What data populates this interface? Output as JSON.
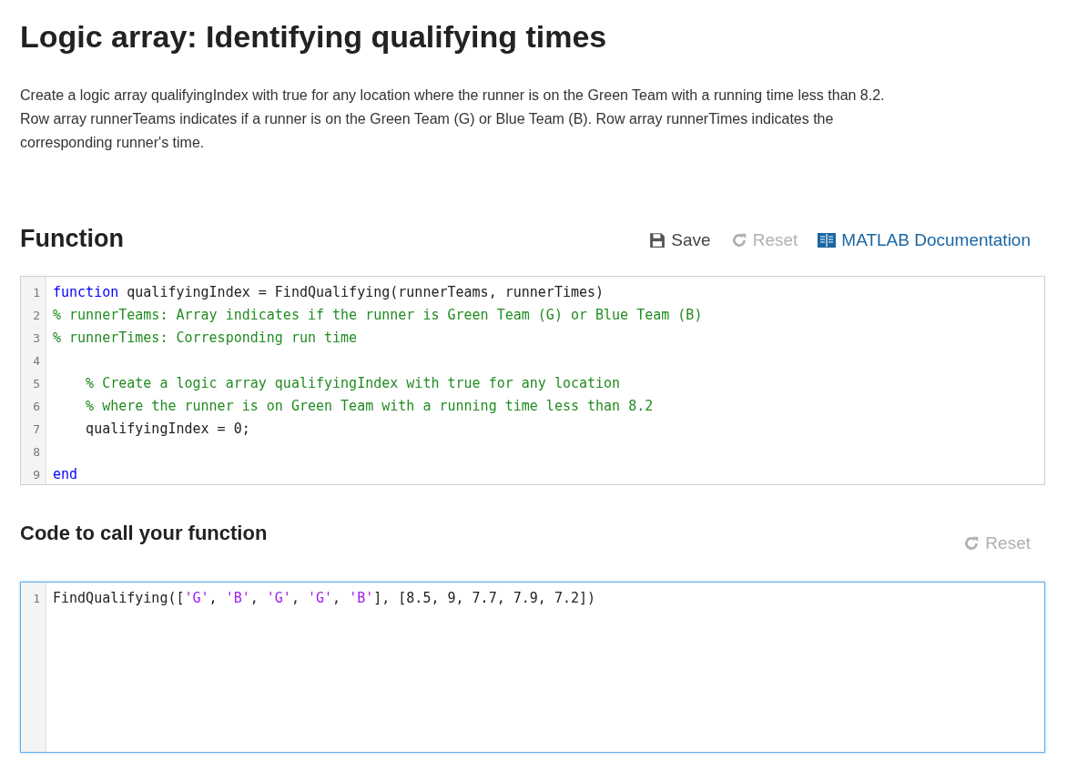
{
  "title": "Logic array: Identifying qualifying times",
  "description": [
    "Create a logic array qualifyingIndex with true for any location where the runner is on the Green Team with a running time less than 8.2.",
    "Row array runnerTeams indicates if a runner is on the Green Team (G) or Blue Team (B). Row array runnerTimes indicates the corresponding runner's time."
  ],
  "function_section": {
    "heading": "Function",
    "toolbar": [
      {
        "kind": "save",
        "label": "Save",
        "disabled": false
      },
      {
        "kind": "reset",
        "label": "Reset",
        "disabled": true
      },
      {
        "kind": "docs",
        "label": "MATLAB Documentation",
        "disabled": false
      }
    ],
    "editor": {
      "focused": false,
      "lines": [
        {
          "number": "1",
          "tokens": [
            {
              "kind": "keyword",
              "text": "function"
            },
            {
              "kind": "plain",
              "text": " qualifyingIndex = FindQualifying(runnerTeams, runnerTimes)"
            }
          ]
        },
        {
          "number": "2",
          "tokens": [
            {
              "kind": "comment",
              "text": "% runnerTeams: Array indicates if the runner is Green Team (G) or Blue Team (B)"
            }
          ]
        },
        {
          "number": "3",
          "tokens": [
            {
              "kind": "comment",
              "text": "% runnerTimes: Corresponding run time"
            }
          ]
        },
        {
          "number": "4"
        },
        {
          "number": "5",
          "tokens": [
            {
              "kind": "comment",
              "text": "    % Create a logic array qualifyingIndex with true for any location"
            }
          ]
        },
        {
          "number": "6",
          "tokens": [
            {
              "kind": "comment",
              "text": "    % where the runner is on Green Team with a running time less than 8.2"
            }
          ]
        },
        {
          "number": "7",
          "tokens": [
            {
              "kind": "plain",
              "text": "    qualifyingIndex = 0;"
            }
          ]
        },
        {
          "number": "8"
        },
        {
          "number": "9",
          "tokens": [
            {
              "kind": "keyword",
              "text": "end"
            }
          ]
        }
      ]
    }
  },
  "call_section": {
    "heading": "Code to call your function",
    "toolbar": [
      {
        "kind": "reset",
        "label": "Reset",
        "disabled": true
      }
    ],
    "editor": {
      "focused": true,
      "lines": [
        {
          "number": "1",
          "tokens": [
            {
              "kind": "plain",
              "text": "FindQualifying(["
            },
            {
              "kind": "string",
              "text": "'G'"
            },
            {
              "kind": "plain",
              "text": ", "
            },
            {
              "kind": "string",
              "text": "'B'"
            },
            {
              "kind": "plain",
              "text": ", "
            },
            {
              "kind": "string",
              "text": "'G'"
            },
            {
              "kind": "plain",
              "text": ", "
            },
            {
              "kind": "string",
              "text": "'G'"
            },
            {
              "kind": "plain",
              "text": ", "
            },
            {
              "kind": "string",
              "text": "'B'"
            },
            {
              "kind": "plain",
              "text": "], [8.5, 9, 7.7, 7.9, 7.2])"
            }
          ]
        }
      ]
    }
  }
}
